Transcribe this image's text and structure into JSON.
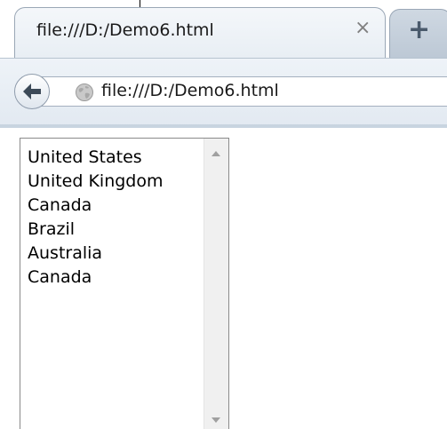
{
  "tab": {
    "title": "file:///D:/Demo6.html",
    "close_glyph": "×",
    "newtab_glyph": "+"
  },
  "navbar": {
    "url": "file:///D:/Demo6.html",
    "back_icon": "back-arrow-icon",
    "site_icon": "globe-icon"
  },
  "listbox": {
    "items": [
      {
        "label": "United States"
      },
      {
        "label": "United Kingdom"
      },
      {
        "label": "Canada"
      },
      {
        "label": "Brazil"
      },
      {
        "label": "Australia"
      },
      {
        "label": "Canada"
      }
    ]
  },
  "colors": {
    "tab_border": "#9aa7b6",
    "navbar_bg": "#e2e9f1",
    "listbox_border": "#8a8a8a",
    "scrollbar_bg": "#f0f0f0"
  }
}
